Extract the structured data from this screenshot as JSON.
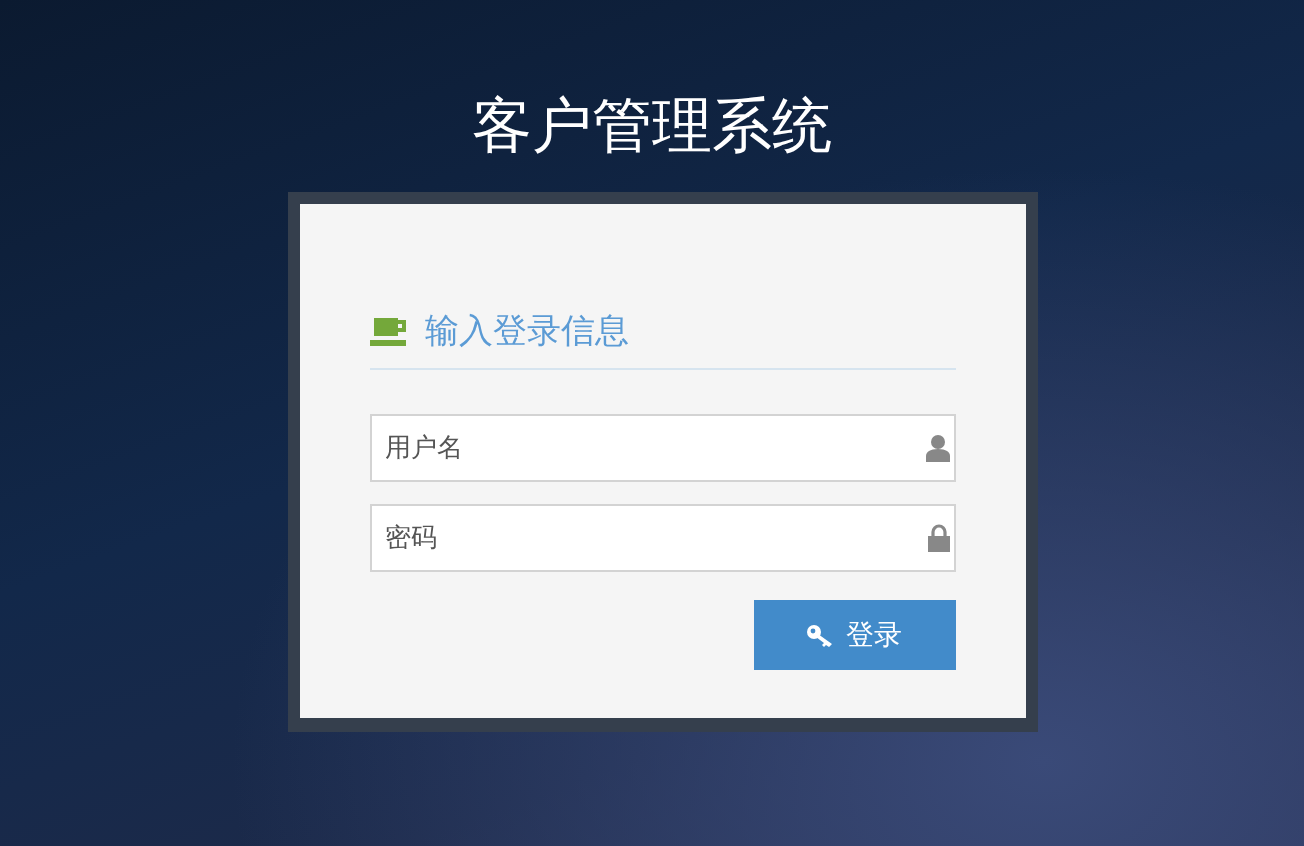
{
  "title": "客户管理系统",
  "login": {
    "heading": "输入登录信息",
    "fields": [
      {
        "kind": "user",
        "placeholder": "用户名"
      },
      {
        "kind": "password",
        "placeholder": "密码"
      }
    ],
    "button": "登录"
  }
}
